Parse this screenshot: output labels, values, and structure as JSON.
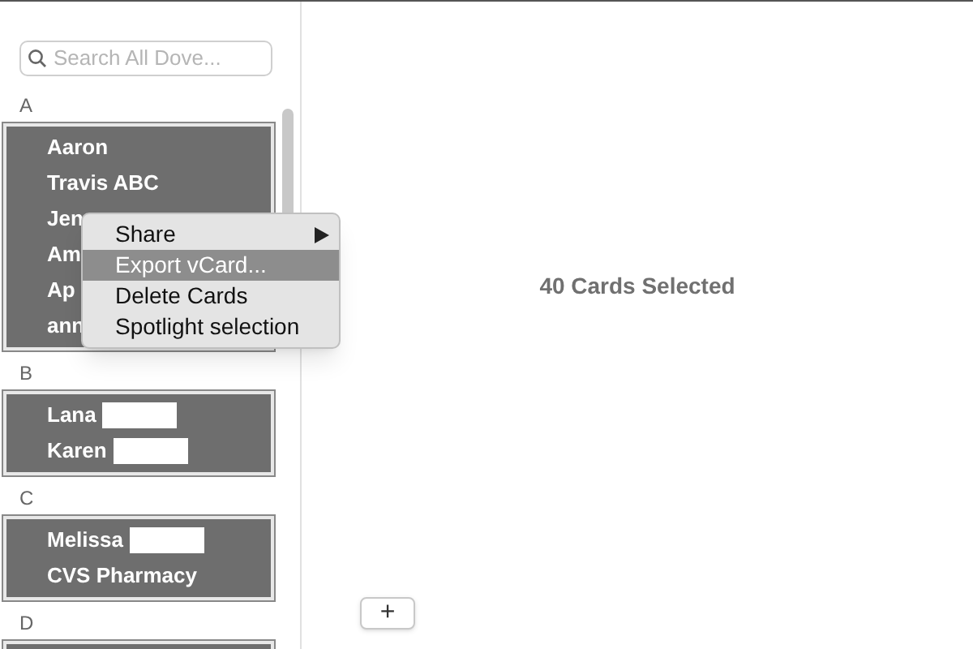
{
  "search": {
    "placeholder": "Search All Dove..."
  },
  "sections": [
    {
      "letter": "A",
      "contacts": [
        {
          "name": "Aaron",
          "redacted": false
        },
        {
          "name": "Travis ABC",
          "redacted": false
        },
        {
          "name": "Jen",
          "redacted": false
        },
        {
          "name": "Am",
          "redacted": false
        },
        {
          "name": "Ap",
          "redacted": false
        },
        {
          "name": "ann",
          "redacted": false
        }
      ]
    },
    {
      "letter": "B",
      "contacts": [
        {
          "name": "Lana",
          "redacted": true
        },
        {
          "name": "Karen",
          "redacted": true
        }
      ]
    },
    {
      "letter": "C",
      "contacts": [
        {
          "name": "Melissa",
          "redacted": true
        },
        {
          "name": "CVS Pharmacy",
          "redacted": false
        }
      ]
    },
    {
      "letter": "D"
    }
  ],
  "context_menu": [
    {
      "label": "Share",
      "submenu": true,
      "selected": false
    },
    {
      "label": "Export vCard...",
      "submenu": false,
      "selected": true
    },
    {
      "label": "Delete Cards",
      "submenu": false,
      "selected": false
    },
    {
      "label": "Spotlight selection",
      "submenu": false,
      "selected": false
    }
  ],
  "detail": {
    "title": "40 Cards Selected",
    "add_button": "+"
  }
}
